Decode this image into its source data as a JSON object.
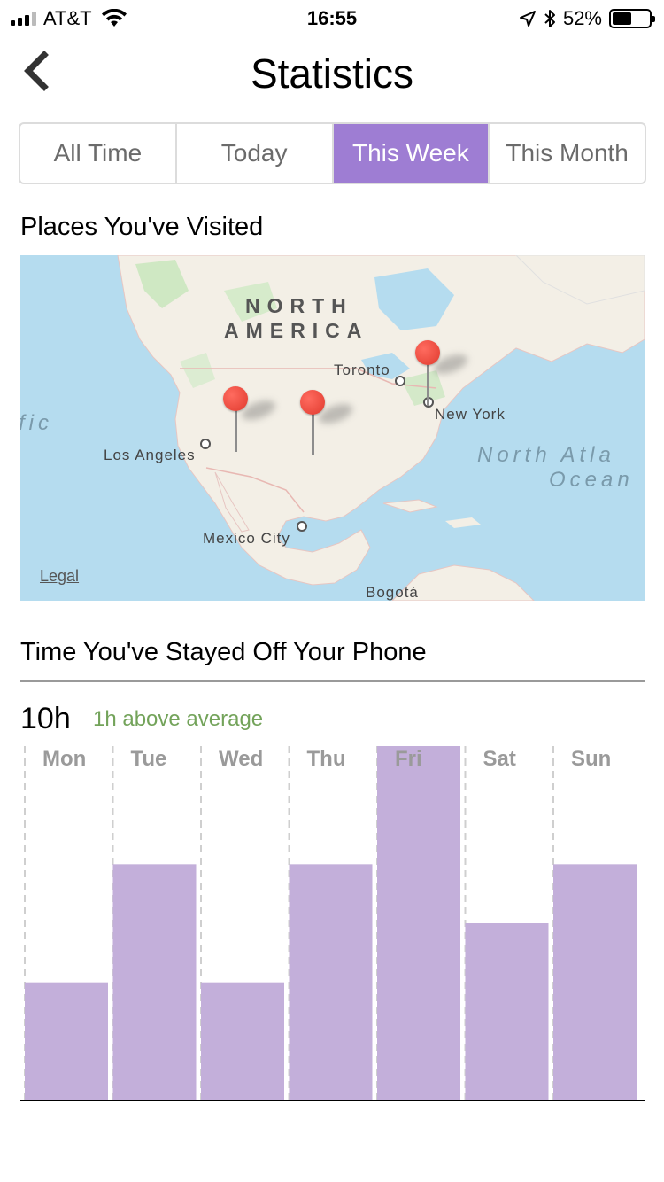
{
  "status_bar": {
    "carrier": "AT&T",
    "time": "16:55",
    "battery_text": "52%",
    "battery_level": 0.52
  },
  "nav": {
    "title": "Statistics",
    "back_icon": "chevron-left-icon"
  },
  "segments": [
    {
      "label": "All Time",
      "active": false
    },
    {
      "label": "Today",
      "active": false
    },
    {
      "label": "This Week",
      "active": true
    },
    {
      "label": "This Month",
      "active": false
    }
  ],
  "map_section": {
    "title": "Places You've Visited",
    "continent": [
      "NORTH",
      "AMERICA"
    ],
    "cities": [
      "Toronto",
      "New York",
      "Los Angeles",
      "Mexico City",
      "Bogotá"
    ],
    "oceans": [
      "North Atla",
      "Ocean",
      "fic"
    ],
    "legal": "Legal"
  },
  "time_section": {
    "title": "Time You've Stayed Off Your Phone",
    "total": "10h",
    "comparison": "1h above average"
  },
  "colors": {
    "accent": "#9e7dd3",
    "bar": "#c3afda",
    "positive_text": "#73a35a",
    "map_water": "#b5dcef",
    "map_land": "#f3efe6",
    "pin": "#e03a2e"
  },
  "chart_data": {
    "type": "bar",
    "categories": [
      "Mon",
      "Tue",
      "Wed",
      "Thu",
      "Fri",
      "Sat",
      "Sun"
    ],
    "values": [
      1,
      2,
      1,
      2,
      3,
      1.5,
      2
    ],
    "ylim": [
      0,
      3
    ],
    "grid": "vertical-dashed",
    "title": "",
    "xlabel": "",
    "ylabel": ""
  }
}
